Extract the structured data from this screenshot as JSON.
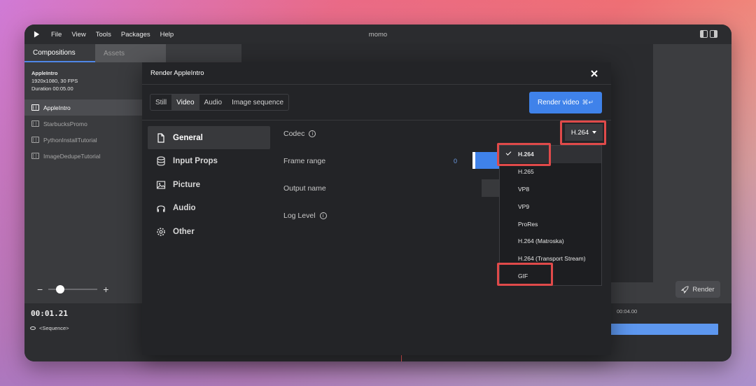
{
  "app": {
    "window_title": "momo",
    "menu": [
      "File",
      "View",
      "Tools",
      "Packages",
      "Help"
    ]
  },
  "sidebar": {
    "tabs": [
      "Compositions",
      "Assets"
    ],
    "composition_info": {
      "name": "AppleIntro",
      "spec": "1920x1080, 30 FPS",
      "duration": "Duration 00:05.00"
    },
    "items": [
      "AppleIntro",
      "StarbucksPromo",
      "PythonInstallTutorial",
      "ImageDedupeTutorial"
    ]
  },
  "zoom": {
    "minus": "−",
    "plus": "+",
    "level": 0.15
  },
  "timeline": {
    "current_time": "00:01.21",
    "sequence_label": "<Sequence>",
    "ruler_time": "00:04.00"
  },
  "render_button": {
    "label": "Render"
  },
  "modal": {
    "title": "Render AppleIntro",
    "segments": [
      "Still",
      "Video",
      "Audio",
      "Image sequence"
    ],
    "selected_segment": "Video",
    "render_video": {
      "label": "Render video",
      "shortcut": "⌘↵"
    },
    "nav": [
      {
        "label": "General",
        "icon": "file-icon"
      },
      {
        "label": "Input Props",
        "icon": "database-icon"
      },
      {
        "label": "Picture",
        "icon": "image-icon"
      },
      {
        "label": "Audio",
        "icon": "headphones-icon"
      },
      {
        "label": "Other",
        "icon": "gear-icon"
      }
    ],
    "fields": {
      "codec": "Codec",
      "frame_range": "Frame range",
      "frame_range_start": "0",
      "output_name": "Output name",
      "log_level": "Log Level"
    },
    "codec_selected": "H.264",
    "codec_options": [
      "H.264",
      "H.265",
      "VP8",
      "VP9",
      "ProRes",
      "H.264 (Matroska)",
      "H.264 (Transport Stream)",
      "GIF"
    ]
  },
  "colors": {
    "accent": "#3f82ea",
    "highlight": "#e04a4a"
  }
}
